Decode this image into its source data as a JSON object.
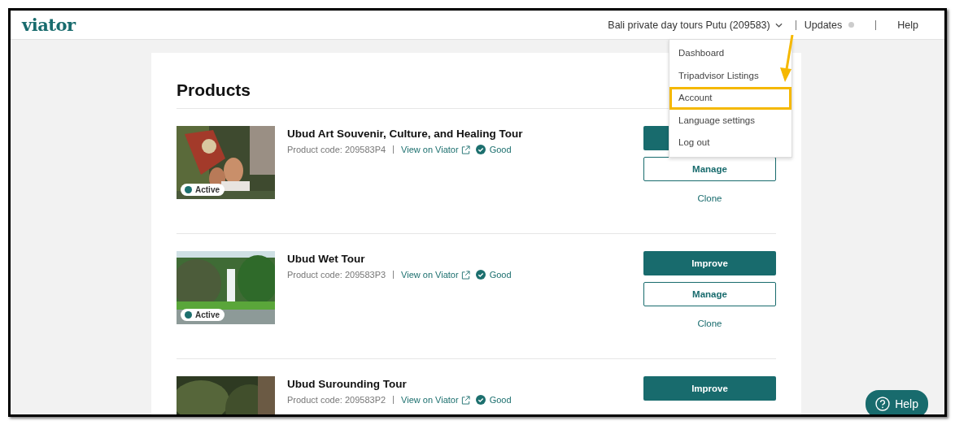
{
  "header": {
    "logo": "viator",
    "account": "Bali private day tours Putu (209583)",
    "updates": "Updates",
    "help": "Help"
  },
  "account_menu": {
    "items": [
      {
        "label": "Dashboard",
        "highlighted": false
      },
      {
        "label": "Tripadvisor Listings",
        "highlighted": false
      },
      {
        "label": "Account",
        "highlighted": true
      },
      {
        "label": "Language settings",
        "highlighted": false
      },
      {
        "label": "Log out",
        "highlighted": false
      }
    ]
  },
  "page": {
    "title": "Products"
  },
  "products": [
    {
      "title": "Ubud Art Souvenir, Culture, and Healing Tour",
      "code": "Product code: 209583P4",
      "link": "View on Viator",
      "quality": "Good",
      "status": "Active",
      "buttons": [
        {
          "kind": "primary"
        },
        {
          "kind": "secondary",
          "label": "Manage"
        },
        {
          "kind": "link",
          "label": "Clone"
        }
      ]
    },
    {
      "title": "Ubud Wet Tour",
      "code": "Product code: 209583P3",
      "link": "View on Viator",
      "quality": "Good",
      "status": "Active",
      "buttons": [
        {
          "kind": "primary",
          "label": "Improve"
        },
        {
          "kind": "secondary",
          "label": "Manage"
        },
        {
          "kind": "link",
          "label": "Clone"
        }
      ]
    },
    {
      "title": "Ubud Surounding Tour",
      "code": "Product code: 209583P2",
      "link": "View on Viator",
      "quality": "Good",
      "buttons": [
        {
          "kind": "primary",
          "label": "Improve"
        }
      ]
    }
  ],
  "help_button": {
    "label": "Help"
  }
}
